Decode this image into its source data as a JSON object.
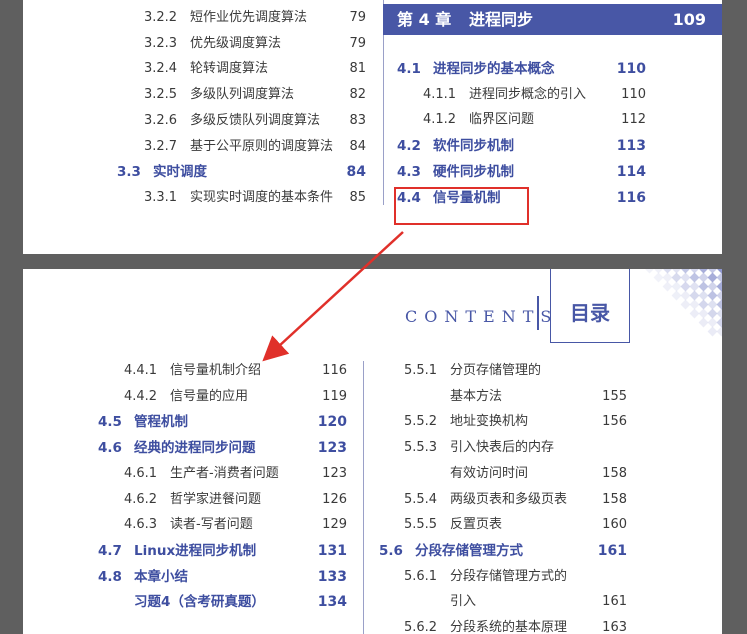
{
  "top_left": [
    {
      "num": "3.2.2",
      "title": "短作业优先调度算法",
      "page": "79",
      "kind": "sub"
    },
    {
      "num": "3.2.3",
      "title": "优先级调度算法",
      "page": "79",
      "kind": "sub"
    },
    {
      "num": "3.2.4",
      "title": "轮转调度算法",
      "page": "81",
      "kind": "sub"
    },
    {
      "num": "3.2.5",
      "title": "多级队列调度算法",
      "page": "82",
      "kind": "sub"
    },
    {
      "num": "3.2.6",
      "title": "多级反馈队列调度算法",
      "page": "83",
      "kind": "sub"
    },
    {
      "num": "3.2.7",
      "title": "基于公平原则的调度算法",
      "page": "84",
      "kind": "sub"
    },
    {
      "num": "3.3",
      "title": "实时调度",
      "page": "84",
      "kind": "sec"
    },
    {
      "num": "3.3.1",
      "title": "实现实时调度的基本条件",
      "page": "85",
      "kind": "sub"
    }
  ],
  "chapter_header": {
    "label": "第 4 章",
    "title": "进程同步",
    "page": "109"
  },
  "top_right": [
    {
      "num": "4.1",
      "title": "进程同步的基本概念",
      "page": "110",
      "kind": "sec"
    },
    {
      "num": "4.1.1",
      "title": "进程同步概念的引入",
      "page": "110",
      "kind": "sub"
    },
    {
      "num": "4.1.2",
      "title": "临界区问题",
      "page": "112",
      "kind": "sub"
    },
    {
      "num": "4.2",
      "title": "软件同步机制",
      "page": "113",
      "kind": "sec"
    },
    {
      "num": "4.3",
      "title": "硬件同步机制",
      "page": "114",
      "kind": "sec"
    },
    {
      "num": "4.4",
      "title": "信号量机制",
      "page": "116",
      "kind": "sec"
    }
  ],
  "contents_label": "CONTENTS",
  "mulu_label": "目录",
  "bottom_left": [
    {
      "num": "4.4.1",
      "title": "信号量机制介绍",
      "page": "116",
      "kind": "sub"
    },
    {
      "num": "4.4.2",
      "title": "信号量的应用",
      "page": "119",
      "kind": "sub"
    },
    {
      "num": "4.5",
      "title": "管程机制",
      "page": "120",
      "kind": "sec"
    },
    {
      "num": "4.6",
      "title": "经典的进程同步问题",
      "page": "123",
      "kind": "sec"
    },
    {
      "num": "4.6.1",
      "title": "生产者-消费者问题",
      "page": "123",
      "kind": "sub"
    },
    {
      "num": "4.6.2",
      "title": "哲学家进餐问题",
      "page": "126",
      "kind": "sub"
    },
    {
      "num": "4.6.3",
      "title": "读者-写者问题",
      "page": "129",
      "kind": "sub"
    },
    {
      "num": "4.7",
      "title": "Linux进程同步机制",
      "page": "131",
      "kind": "sec"
    },
    {
      "num": "4.8",
      "title": "本章小结",
      "page": "133",
      "kind": "sec"
    },
    {
      "num": "",
      "title": "习题4（含考研真题）",
      "page": "134",
      "kind": "sec"
    }
  ],
  "bottom_right": [
    {
      "num": "5.5.1",
      "title": "分页存储管理的",
      "page": "",
      "kind": "sub"
    },
    {
      "num": "",
      "title": "基本方法",
      "page": "155",
      "kind": "sub"
    },
    {
      "num": "5.5.2",
      "title": "地址变换机构",
      "page": "156",
      "kind": "sub"
    },
    {
      "num": "5.5.3",
      "title": "引入快表后的内存",
      "page": "",
      "kind": "sub"
    },
    {
      "num": "",
      "title": "有效访问时间",
      "page": "158",
      "kind": "sub"
    },
    {
      "num": "5.5.4",
      "title": "两级页表和多级页表",
      "page": "158",
      "kind": "sub"
    },
    {
      "num": "5.5.5",
      "title": "反置页表",
      "page": "160",
      "kind": "sub"
    },
    {
      "num": "5.6",
      "title": "分段存储管理方式",
      "page": "161",
      "kind": "sec"
    },
    {
      "num": "5.6.1",
      "title": "分段存储管理方式的",
      "page": "",
      "kind": "sub"
    },
    {
      "num": "",
      "title": "引入",
      "page": "161",
      "kind": "sub"
    },
    {
      "num": "5.6.2",
      "title": "分段系统的基本原理",
      "page": "163",
      "kind": "sub"
    }
  ],
  "colors": {
    "accent": "#4857a6",
    "section_text": "#3e4ea0",
    "highlight": "#e0302a",
    "backdrop": "#5f5f5f"
  }
}
